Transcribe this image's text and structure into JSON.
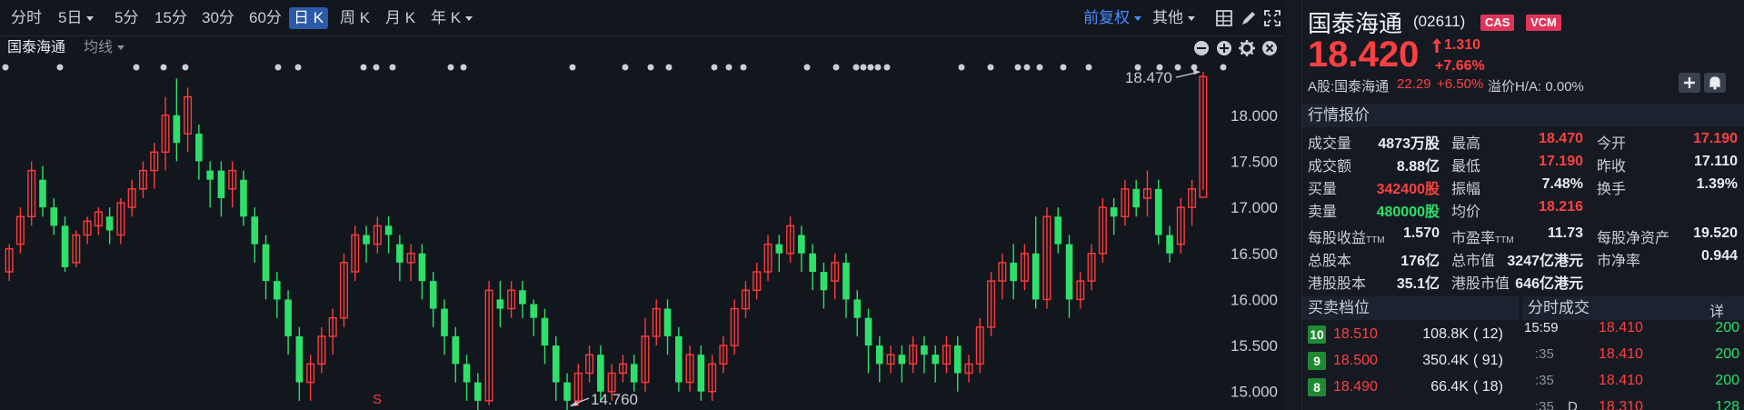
{
  "toolbar": {
    "periods": [
      "分时",
      "5日",
      "5分",
      "15分",
      "30分",
      "60分",
      "日 K",
      "周 K",
      "月 K",
      "年 K"
    ],
    "active_period": "日 K",
    "adjust": "前复权",
    "other": "其他"
  },
  "subbar": {
    "stock_name": "国泰海通",
    "ma": "均线"
  },
  "chart_data": {
    "type": "candlestick",
    "y_ticks": [
      "18.000",
      "17.500",
      "17.000",
      "16.500",
      "16.000",
      "15.500",
      "15.000"
    ],
    "ylim": [
      14.8,
      18.6
    ],
    "high_label": "18.470",
    "high_value": 18.47,
    "low_label": "14.760",
    "low_value": 14.76,
    "marker_s": "S",
    "colors": {
      "up": "#ff3b3b",
      "down": "#2ee06a"
    },
    "candles": [
      [
        16.3,
        16.55,
        16.2,
        16.6
      ],
      [
        16.6,
        16.9,
        16.5,
        17.0
      ],
      [
        16.9,
        17.4,
        16.8,
        17.5
      ],
      [
        17.3,
        17.0,
        16.9,
        17.45
      ],
      [
        17.0,
        16.8,
        16.7,
        17.1
      ],
      [
        16.8,
        16.35,
        16.3,
        16.9
      ],
      [
        16.4,
        16.7,
        16.35,
        16.75
      ],
      [
        16.7,
        16.85,
        16.6,
        16.9
      ],
      [
        16.8,
        16.95,
        16.7,
        17.0
      ],
      [
        16.9,
        16.75,
        16.6,
        17.0
      ],
      [
        16.7,
        17.05,
        16.6,
        17.1
      ],
      [
        17.0,
        17.2,
        16.9,
        17.3
      ],
      [
        17.2,
        17.4,
        17.1,
        17.5
      ],
      [
        17.4,
        17.6,
        17.2,
        17.7
      ],
      [
        17.6,
        18.0,
        17.4,
        18.2
      ],
      [
        18.0,
        17.7,
        17.5,
        18.4
      ],
      [
        17.8,
        18.2,
        17.6,
        18.3
      ],
      [
        17.8,
        17.5,
        17.3,
        17.9
      ],
      [
        17.4,
        17.3,
        17.0,
        17.5
      ],
      [
        17.4,
        17.1,
        16.9,
        17.5
      ],
      [
        17.2,
        17.4,
        17.0,
        17.5
      ],
      [
        17.3,
        16.9,
        16.8,
        17.4
      ],
      [
        16.9,
        16.6,
        16.4,
        17.0
      ],
      [
        16.6,
        16.2,
        16.0,
        16.7
      ],
      [
        16.2,
        16.0,
        15.8,
        16.3
      ],
      [
        16.0,
        15.6,
        15.4,
        16.1
      ],
      [
        15.6,
        15.1,
        14.9,
        15.7
      ],
      [
        15.1,
        15.3,
        14.9,
        15.4
      ],
      [
        15.3,
        15.6,
        15.2,
        15.7
      ],
      [
        15.6,
        15.8,
        15.4,
        15.9
      ],
      [
        15.8,
        16.4,
        15.7,
        16.5
      ],
      [
        16.3,
        16.7,
        16.2,
        16.8
      ],
      [
        16.7,
        16.6,
        16.4,
        16.8
      ],
      [
        16.6,
        16.8,
        16.5,
        16.9
      ],
      [
        16.8,
        16.7,
        16.5,
        16.9
      ],
      [
        16.6,
        16.4,
        16.2,
        16.7
      ],
      [
        16.4,
        16.5,
        16.2,
        16.6
      ],
      [
        16.5,
        16.2,
        16.0,
        16.6
      ],
      [
        16.2,
        15.9,
        15.7,
        16.3
      ],
      [
        15.9,
        15.6,
        15.4,
        16.0
      ],
      [
        15.6,
        15.3,
        15.1,
        15.7
      ],
      [
        15.3,
        15.1,
        14.9,
        15.4
      ],
      [
        15.1,
        14.9,
        14.8,
        15.2
      ],
      [
        14.9,
        16.1,
        14.85,
        16.2
      ],
      [
        16.0,
        15.9,
        15.7,
        16.2
      ],
      [
        15.9,
        16.1,
        15.8,
        16.2
      ],
      [
        16.1,
        15.95,
        15.8,
        16.2
      ],
      [
        15.95,
        15.8,
        15.6,
        16.0
      ],
      [
        15.8,
        15.5,
        15.3,
        15.9
      ],
      [
        15.5,
        15.1,
        14.9,
        15.6
      ],
      [
        15.1,
        14.9,
        14.76,
        15.2
      ],
      [
        14.9,
        15.2,
        14.85,
        15.3
      ],
      [
        15.2,
        15.4,
        15.1,
        15.5
      ],
      [
        15.4,
        15.0,
        14.9,
        15.5
      ],
      [
        15.0,
        15.2,
        14.9,
        15.3
      ],
      [
        15.2,
        15.3,
        15.1,
        15.4
      ],
      [
        15.3,
        15.1,
        15.0,
        15.4
      ],
      [
        15.1,
        15.6,
        15.0,
        15.8
      ],
      [
        15.6,
        15.9,
        15.5,
        16.0
      ],
      [
        15.9,
        15.6,
        15.4,
        16.0
      ],
      [
        15.6,
        15.1,
        15.0,
        15.7
      ],
      [
        15.1,
        15.4,
        15.0,
        15.5
      ],
      [
        15.4,
        15.0,
        14.9,
        15.5
      ],
      [
        15.0,
        15.3,
        14.9,
        15.4
      ],
      [
        15.3,
        15.5,
        15.2,
        15.6
      ],
      [
        15.5,
        15.9,
        15.4,
        16.0
      ],
      [
        15.9,
        16.1,
        15.8,
        16.2
      ],
      [
        16.1,
        16.3,
        16.0,
        16.4
      ],
      [
        16.3,
        16.6,
        16.2,
        16.7
      ],
      [
        16.6,
        16.5,
        16.3,
        16.7
      ],
      [
        16.5,
        16.8,
        16.4,
        16.9
      ],
      [
        16.7,
        16.5,
        16.3,
        16.8
      ],
      [
        16.5,
        16.3,
        16.1,
        16.6
      ],
      [
        16.3,
        16.1,
        15.9,
        16.4
      ],
      [
        16.2,
        16.4,
        16.0,
        16.5
      ],
      [
        16.4,
        16.0,
        15.8,
        16.5
      ],
      [
        16.0,
        15.8,
        15.6,
        16.1
      ],
      [
        15.8,
        15.5,
        15.2,
        15.9
      ],
      [
        15.5,
        15.3,
        15.1,
        15.6
      ],
      [
        15.3,
        15.4,
        15.2,
        15.5
      ],
      [
        15.4,
        15.3,
        15.1,
        15.5
      ],
      [
        15.3,
        15.5,
        15.2,
        15.6
      ],
      [
        15.5,
        15.4,
        15.2,
        15.6
      ],
      [
        15.4,
        15.3,
        15.1,
        15.5
      ],
      [
        15.3,
        15.5,
        15.2,
        15.6
      ],
      [
        15.5,
        15.2,
        15.0,
        15.6
      ],
      [
        15.2,
        15.3,
        15.1,
        15.4
      ],
      [
        15.3,
        15.7,
        15.2,
        15.8
      ],
      [
        15.7,
        16.2,
        15.6,
        16.3
      ],
      [
        16.2,
        16.4,
        16.0,
        16.5
      ],
      [
        16.4,
        16.2,
        16.0,
        16.6
      ],
      [
        16.2,
        16.5,
        16.1,
        16.6
      ],
      [
        16.5,
        16.0,
        15.9,
        16.9
      ],
      [
        16.0,
        16.9,
        15.9,
        17.0
      ],
      [
        16.9,
        16.6,
        16.5,
        17.0
      ],
      [
        16.6,
        16.0,
        15.8,
        16.7
      ],
      [
        16.0,
        16.2,
        15.9,
        16.3
      ],
      [
        16.2,
        16.5,
        16.1,
        16.6
      ],
      [
        16.5,
        17.0,
        16.4,
        17.1
      ],
      [
        17.0,
        16.9,
        16.7,
        17.1
      ],
      [
        16.9,
        17.2,
        16.8,
        17.3
      ],
      [
        17.2,
        17.0,
        16.9,
        17.3
      ],
      [
        17.1,
        17.2,
        16.9,
        17.4
      ],
      [
        17.2,
        16.7,
        16.6,
        17.3
      ],
      [
        16.7,
        16.5,
        16.4,
        16.8
      ],
      [
        16.6,
        17.0,
        16.5,
        17.1
      ],
      [
        17.0,
        17.2,
        16.8,
        17.3
      ],
      [
        17.11,
        18.42,
        17.19,
        18.47
      ]
    ]
  },
  "quote": {
    "name": "国泰海通",
    "code": "(02611)",
    "tags": [
      "CAS",
      "VCM"
    ],
    "price": "18.420",
    "change": "1.310",
    "change_pct": "+7.66%",
    "a_share_label": "A股:国泰海通",
    "a_share_price": "22.29",
    "a_share_pct": "+6.50%",
    "premium": "溢价H/A: 0.00%",
    "section_quote": "行情报价",
    "rows": [
      [
        [
          "成交量",
          "4873万股",
          "white"
        ],
        [
          "最高",
          "18.470",
          "red"
        ],
        [
          "今开",
          "17.190",
          "red"
        ]
      ],
      [
        [
          "成交额",
          "8.88亿",
          "white"
        ],
        [
          "最低",
          "17.190",
          "red"
        ],
        [
          "昨收",
          "17.110",
          "white"
        ]
      ],
      [
        [
          "买量",
          "342400股",
          "red"
        ],
        [
          "振幅",
          "7.48%",
          "white"
        ],
        [
          "换手",
          "1.39%",
          "white"
        ]
      ],
      [
        [
          "卖量",
          "480000股",
          "green"
        ],
        [
          "均价",
          "18.216",
          "red"
        ]
      ]
    ],
    "fund_rows": [
      [
        [
          "每股收益",
          "TTM",
          "1.570"
        ],
        [
          "市盈率",
          "TTM",
          "11.73"
        ],
        [
          "每股净资产",
          "",
          "19.520"
        ]
      ],
      [
        [
          "总股本",
          "",
          "176亿"
        ],
        [
          "总市值",
          "",
          "3247亿港元"
        ],
        [
          "市净率",
          "",
          "0.944"
        ]
      ],
      [
        [
          "港股股本",
          "",
          "35.1亿"
        ],
        [
          "港股市值",
          "",
          "646亿港元"
        ]
      ]
    ],
    "section_book": "买卖档位",
    "section_ticks": "分时成交",
    "ticks_detail": "详",
    "book": [
      [
        "10",
        "18.510",
        "108.8K",
        "( 12)"
      ],
      [
        "9",
        "18.500",
        "350.4K",
        "( 91)"
      ],
      [
        "8",
        "18.490",
        "66.4K",
        "( 18)"
      ]
    ],
    "ticks": [
      [
        "15:59",
        "",
        "18.410",
        "200"
      ],
      [
        ":35",
        "",
        "18.410",
        "200"
      ],
      [
        ":35",
        "",
        "18.410",
        "200"
      ],
      [
        ":35",
        "D",
        "18.310",
        "128"
      ]
    ]
  }
}
